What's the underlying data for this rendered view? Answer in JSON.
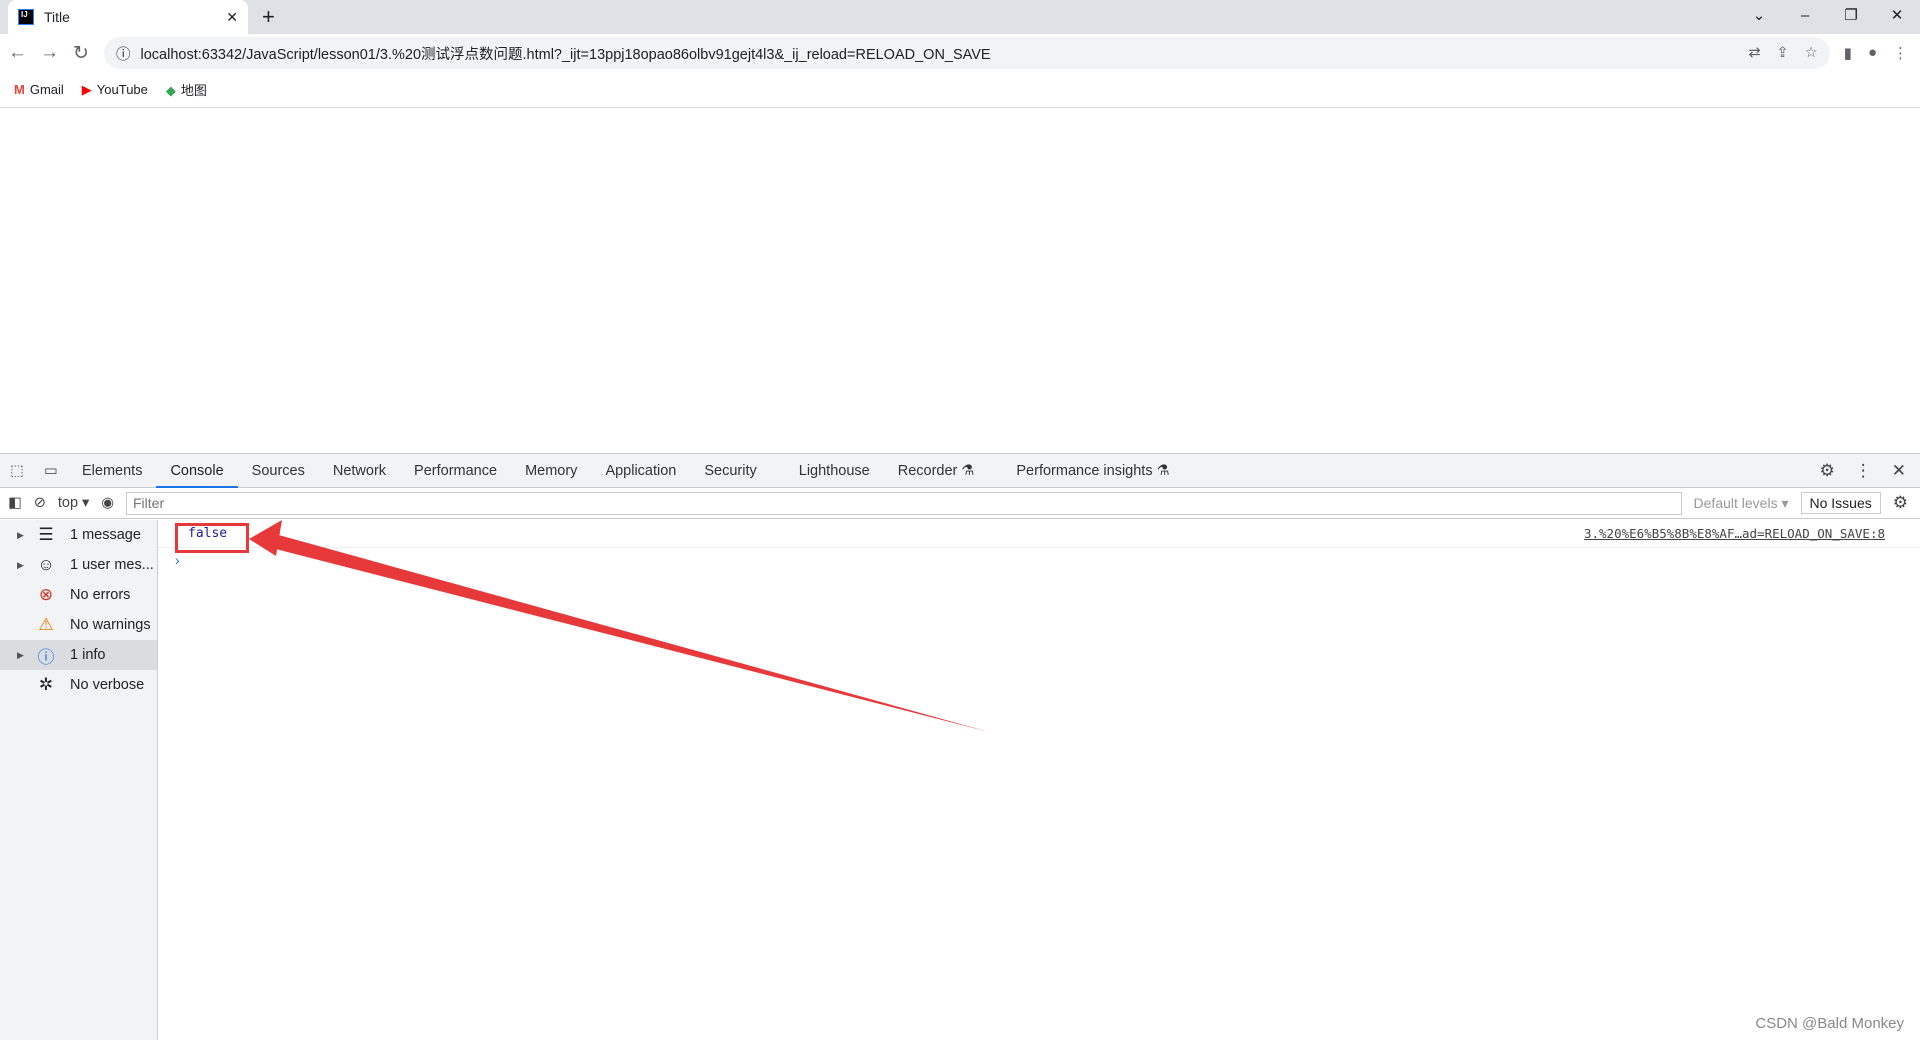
{
  "browser": {
    "tab_title": "Title",
    "url": "localhost:63342/JavaScript/lesson01/3.%20测试浮点数问题.html?_ijt=13ppj18opao86olbv91gejt4l3&_ij_reload=RELOAD_ON_SAVE",
    "bookmarks": [
      {
        "label": "Gmail"
      },
      {
        "label": "YouTube"
      },
      {
        "label": "地图"
      }
    ]
  },
  "devtools": {
    "tabs": [
      "Elements",
      "Console",
      "Sources",
      "Network",
      "Performance",
      "Memory",
      "Application",
      "Security",
      "Lighthouse",
      "Recorder ⚗",
      "Performance insights ⚗"
    ],
    "context": "top",
    "filter_placeholder": "Filter",
    "levels": "Default levels ▾",
    "issues": "No Issues",
    "sidebar": [
      {
        "label": "1 message",
        "icon": "list-icon"
      },
      {
        "label": "1 user mes...",
        "icon": "user-icon"
      },
      {
        "label": "No errors",
        "icon": "error-icon"
      },
      {
        "label": "No warnings",
        "icon": "warning-icon"
      },
      {
        "label": "1 info",
        "icon": "info-icon"
      },
      {
        "label": "No verbose",
        "icon": "bug-icon"
      }
    ],
    "messages": [
      {
        "value": "false",
        "source": "3.%20%E6%B5%8B%E8%AF…ad=RELOAD_ON_SAVE:8"
      }
    ],
    "prompt": "›"
  },
  "watermark": "CSDN @Bald Monkey",
  "colors": {
    "accent": "#1a73e8",
    "annotation": "#e8393a"
  }
}
